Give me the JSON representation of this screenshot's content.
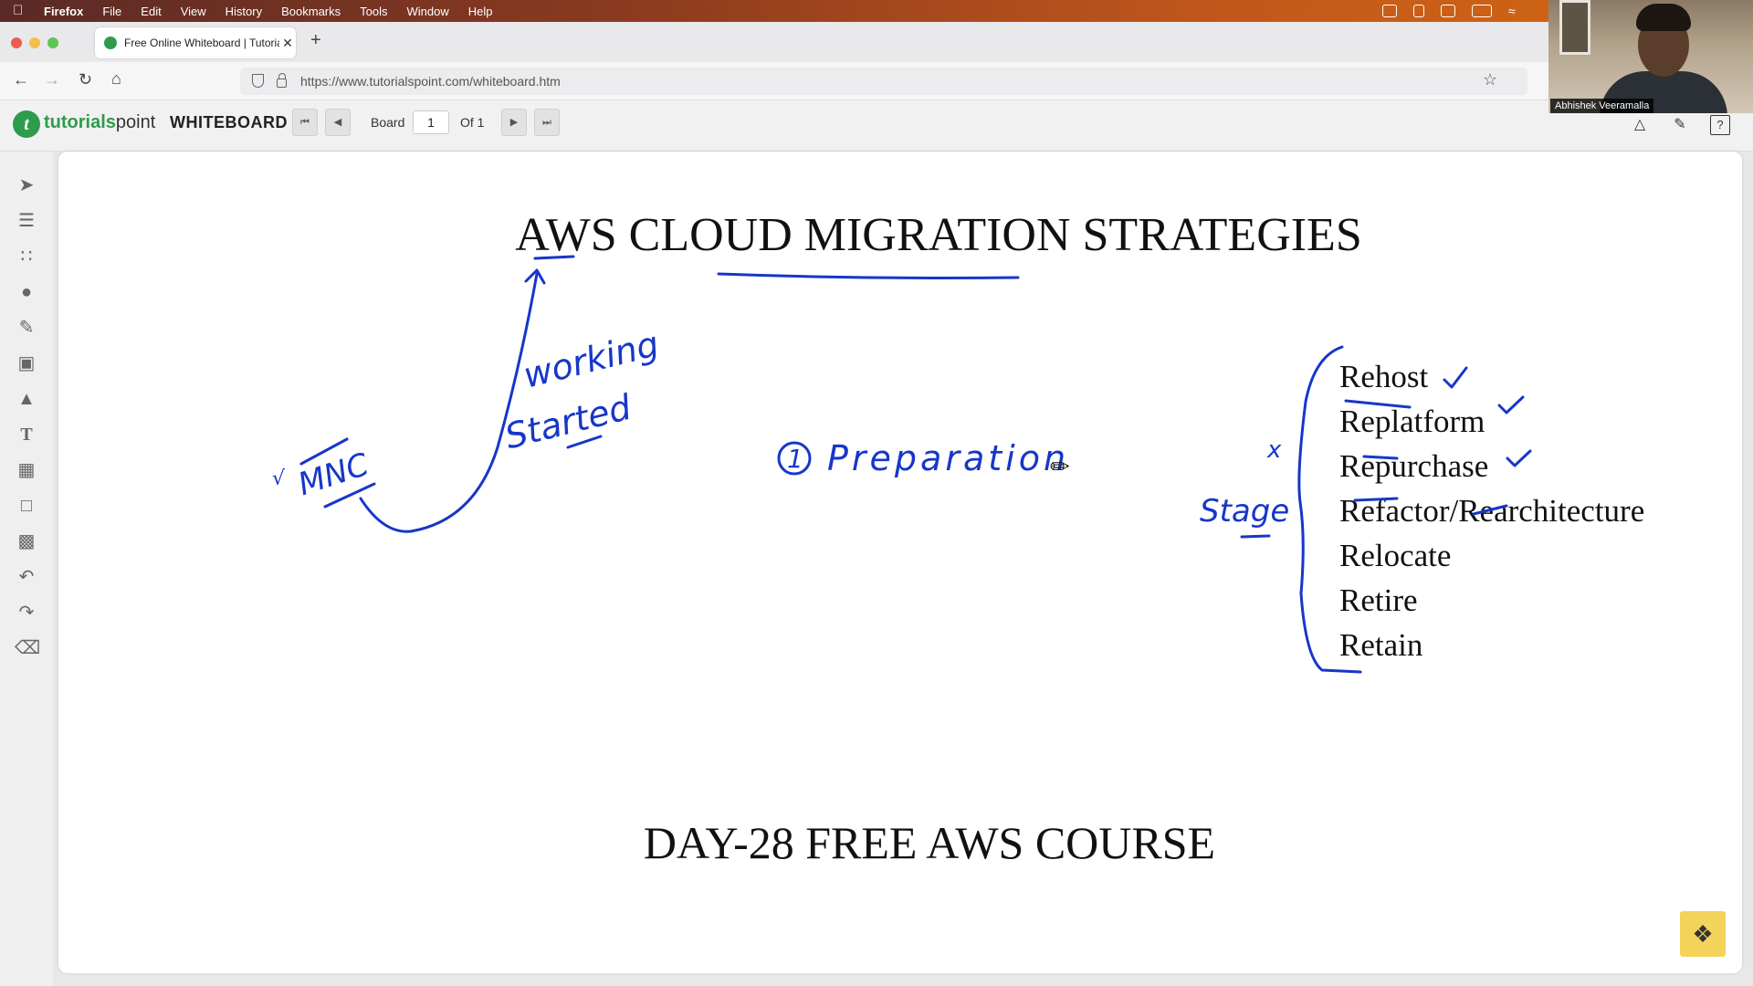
{
  "menubar": {
    "app": "Firefox",
    "items": [
      "File",
      "Edit",
      "View",
      "History",
      "Bookmarks",
      "Tools",
      "Window",
      "Help"
    ]
  },
  "browser": {
    "tab_title": "Free Online Whiteboard | Tutoria",
    "url": "https://www.tutorialspoint.com/whiteboard.htm"
  },
  "app": {
    "logo_brand": "tutorials",
    "logo_brand2": "point",
    "title": "WHITEBOARD",
    "board_label": "Board",
    "board_value": "1",
    "board_of": "Of 1"
  },
  "webcam": {
    "name": "Abhishek Veeramalla"
  },
  "board": {
    "title": "AWS CLOUD MIGRATION STRATEGIES",
    "footer": "DAY-28 FREE AWS COURSE",
    "strategies": [
      "Rehost",
      "Replatform",
      "Repurchase",
      "Refactor/Rearchitecture",
      "Relocate",
      "Retire",
      "Retain"
    ],
    "handwriting": {
      "mnc": "MNC",
      "working": "working",
      "started": "Started",
      "step": "Preparation",
      "step_num": "1",
      "stage": "Stage",
      "x": "x",
      "tick": "√"
    }
  },
  "colors": {
    "ink": "#1736c9",
    "brand": "#2e9c4a",
    "accent": "#f3d35a"
  }
}
